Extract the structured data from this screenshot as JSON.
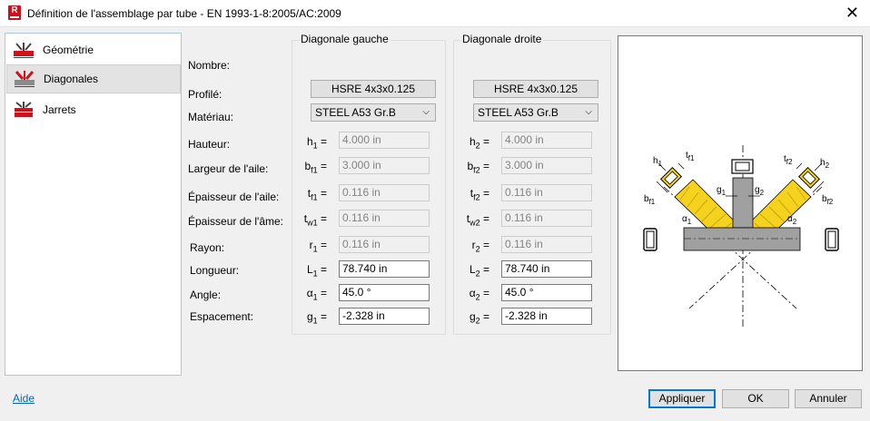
{
  "window": {
    "app_icon_letter": "R",
    "title": "Définition de l'assemblage par tube - EN 1993-1-8:2005/AC:2009"
  },
  "sidebar": {
    "items": [
      {
        "label": "Géométrie",
        "selected": false
      },
      {
        "label": "Diagonales",
        "selected": true
      },
      {
        "label": "Jarrets",
        "selected": false
      }
    ]
  },
  "rows": {
    "nombre": "Nombre:",
    "profile": "Profilé:",
    "material": "Matériau:",
    "hauteur": "Hauteur:",
    "largeur": "Largeur de l'aile:",
    "ep_aile": "Épaisseur de l'aile:",
    "ep_ame": "Épaisseur de l'âme:",
    "rayon": "Rayon:",
    "longueur": "Longueur:",
    "angle": "Angle:",
    "espacement": "Espacement:"
  },
  "eq": "=",
  "left": {
    "title": "Diagonale gauche",
    "profile": "HSRE 4x3x0.125",
    "material": "STEEL A53 Gr.B",
    "h": {
      "sym": "h",
      "sub": "1",
      "value": "4.000 in"
    },
    "bf": {
      "sym": "b",
      "sub": "f1",
      "value": "3.000 in"
    },
    "tf": {
      "sym": "t",
      "sub": "f1",
      "value": "0.116 in"
    },
    "tw": {
      "sym": "t",
      "sub": "w1",
      "value": "0.116 in"
    },
    "r": {
      "sym": "r",
      "sub": "1",
      "value": "0.116 in"
    },
    "L": {
      "sym": "L",
      "sub": "1",
      "value": "78.740 in"
    },
    "alpha": {
      "sym": "α",
      "sub": "1",
      "value": "45.0 °"
    },
    "g": {
      "sym": "g",
      "sub": "1",
      "value": "-2.328 in"
    }
  },
  "right": {
    "title": "Diagonale droite",
    "profile": "HSRE 4x3x0.125",
    "material": "STEEL A53 Gr.B",
    "h": {
      "sym": "h",
      "sub": "2",
      "value": "4.000 in"
    },
    "bf": {
      "sym": "b",
      "sub": "f2",
      "value": "3.000 in"
    },
    "tf": {
      "sym": "t",
      "sub": "f2",
      "value": "0.116 in"
    },
    "tw": {
      "sym": "t",
      "sub": "w2",
      "value": "0.116 in"
    },
    "r": {
      "sym": "r",
      "sub": "2",
      "value": "0.116 in"
    },
    "L": {
      "sym": "L",
      "sub": "2",
      "value": "78.740 in"
    },
    "alpha": {
      "sym": "α",
      "sub": "2",
      "value": "45.0 °"
    },
    "g": {
      "sym": "g",
      "sub": "2",
      "value": "-2.328 in"
    }
  },
  "diagram": {
    "labels": {
      "h1": "h",
      "h1_sub": "1",
      "tf1": "t",
      "tf1_sub": "f1",
      "bf1": "b",
      "bf1_sub": "f1",
      "g1": "g",
      "g1_sub": "1",
      "g2": "g",
      "g2_sub": "2",
      "a1": "α",
      "a1_sub": "1",
      "a2": "α",
      "a2_sub": "2",
      "tf2": "t",
      "tf2_sub": "f2",
      "h2": "h",
      "h2_sub": "2",
      "bf2": "b",
      "bf2_sub": "f2"
    }
  },
  "footer": {
    "help": "Aide",
    "apply": "Appliquer",
    "ok": "OK",
    "cancel": "Annuler"
  },
  "colors": {
    "accent": "#0078d7",
    "diagonal_fill": "#f5d21e",
    "chord_fill": "#a0a0a0",
    "icon_red": "#d0101a"
  }
}
